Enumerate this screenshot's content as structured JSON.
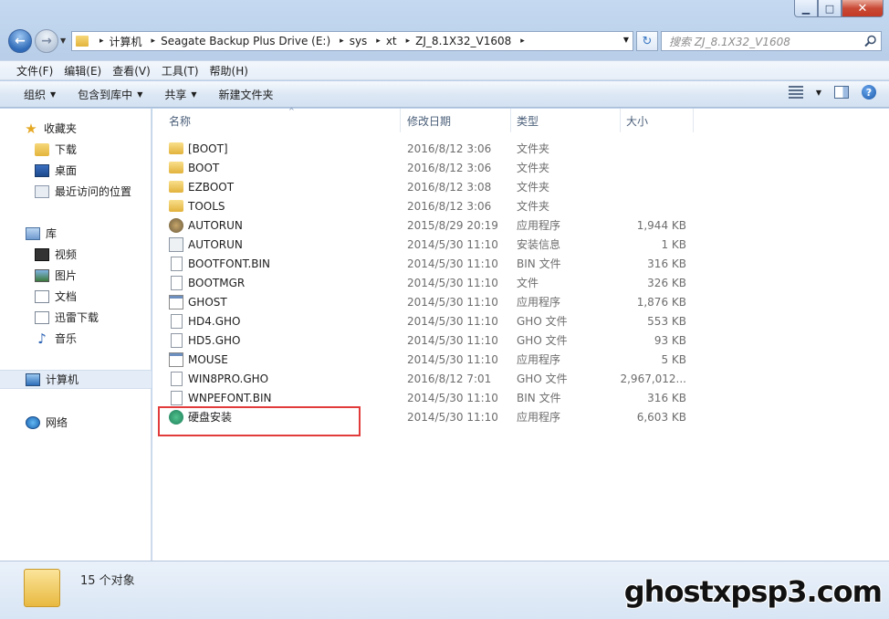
{
  "window": {
    "minimize_glyph": "▁",
    "maximize_glyph": "□",
    "close_glyph": "✕"
  },
  "address": {
    "crumbs": [
      "计算机",
      "Seagate Backup Plus Drive (E:)",
      "sys",
      "xt",
      "ZJ_8.1X32_V1608"
    ],
    "separator": "▸"
  },
  "search": {
    "placeholder": "搜索 ZJ_8.1X32_V1608"
  },
  "menubar": [
    "文件(F)",
    "编辑(E)",
    "查看(V)",
    "工具(T)",
    "帮助(H)"
  ],
  "commandbar": {
    "organize": "组织",
    "include_in_library": "包含到库中",
    "share": "共享",
    "new_folder": "新建文件夹",
    "help": "?"
  },
  "navpane": {
    "favorites": "收藏夹",
    "downloads": "下载",
    "desktop": "桌面",
    "recent": "最近访问的位置",
    "libraries": "库",
    "videos": "视频",
    "pictures": "图片",
    "documents": "文档",
    "thunder_downloads": "迅雷下载",
    "music": "音乐",
    "computer": "计算机",
    "network": "网络"
  },
  "columns": {
    "name": "名称",
    "date": "修改日期",
    "type": "类型",
    "size": "大小"
  },
  "files": [
    {
      "name": "[BOOT]",
      "date": "2016/8/12 3:06",
      "type": "文件夹",
      "size": "",
      "icon": "folder-icon"
    },
    {
      "name": "BOOT",
      "date": "2016/8/12 3:06",
      "type": "文件夹",
      "size": "",
      "icon": "folder-icon"
    },
    {
      "name": "EZBOOT",
      "date": "2016/8/12 3:08",
      "type": "文件夹",
      "size": "",
      "icon": "folder-icon"
    },
    {
      "name": "TOOLS",
      "date": "2016/8/12 3:06",
      "type": "文件夹",
      "size": "",
      "icon": "folder-icon"
    },
    {
      "name": "AUTORUN",
      "date": "2015/8/29 20:19",
      "type": "应用程序",
      "size": "1,944 KB",
      "icon": "autorun-app-icon"
    },
    {
      "name": "AUTORUN",
      "date": "2014/5/30 11:10",
      "type": "安装信息",
      "size": "1 KB",
      "icon": "setup-info-icon"
    },
    {
      "name": "BOOTFONT.BIN",
      "date": "2014/5/30 11:10",
      "type": "BIN 文件",
      "size": "316 KB",
      "icon": "file-icon"
    },
    {
      "name": "BOOTMGR",
      "date": "2014/5/30 11:10",
      "type": "文件",
      "size": "326 KB",
      "icon": "file-icon"
    },
    {
      "name": "GHOST",
      "date": "2014/5/30 11:10",
      "type": "应用程序",
      "size": "1,876 KB",
      "icon": "application-icon"
    },
    {
      "name": "HD4.GHO",
      "date": "2014/5/30 11:10",
      "type": "GHO 文件",
      "size": "553 KB",
      "icon": "file-icon"
    },
    {
      "name": "HD5.GHO",
      "date": "2014/5/30 11:10",
      "type": "GHO 文件",
      "size": "93 KB",
      "icon": "file-icon"
    },
    {
      "name": "MOUSE",
      "date": "2014/5/30 11:10",
      "type": "应用程序",
      "size": "5 KB",
      "icon": "application-icon"
    },
    {
      "name": "WIN8PRO.GHO",
      "date": "2016/8/12 7:01",
      "type": "GHO 文件",
      "size": "2,967,012...",
      "icon": "file-icon"
    },
    {
      "name": "WNPEFONT.BIN",
      "date": "2014/5/30 11:10",
      "type": "BIN 文件",
      "size": "316 KB",
      "icon": "file-icon"
    },
    {
      "name": "硬盘安装",
      "date": "2014/5/30 11:10",
      "type": "应用程序",
      "size": "6,603 KB",
      "icon": "disk-installer-icon"
    }
  ],
  "status": {
    "count": "15 个对象"
  },
  "watermark": "ghostxpsp3.com",
  "colors": {
    "highlight": "#e23b3b"
  }
}
